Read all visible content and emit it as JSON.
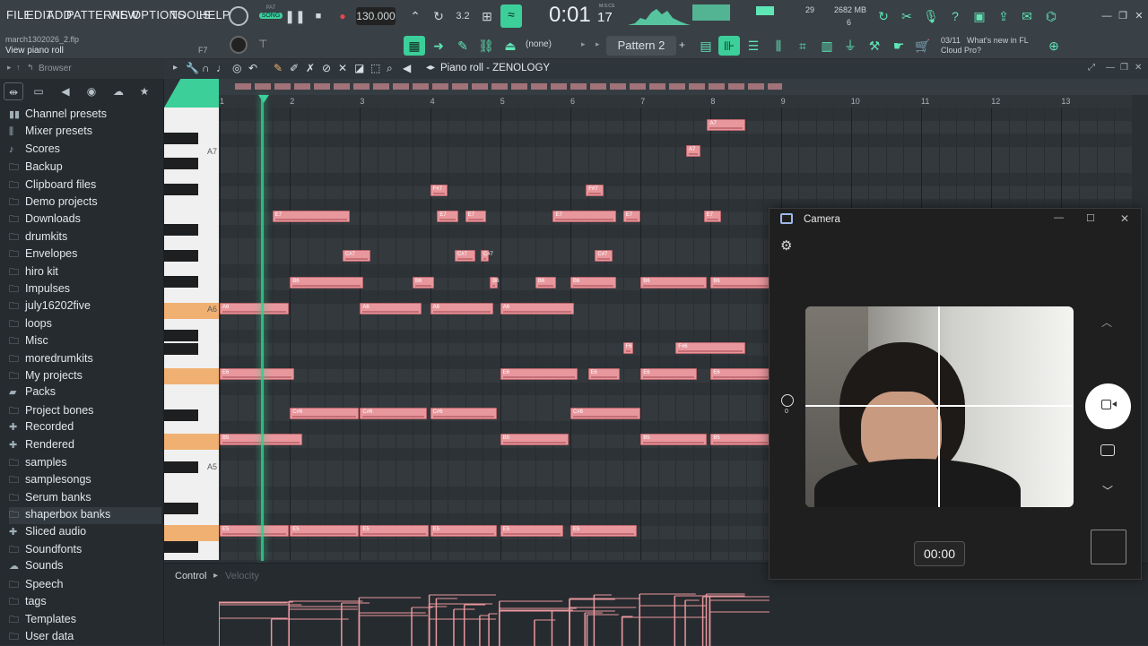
{
  "menu": {
    "items": [
      "FILE",
      "EDIT",
      "ADD",
      "PATTERNS",
      "VIEW",
      "OPTIONS",
      "TOOLS",
      "HELP"
    ]
  },
  "transport": {
    "pat_label": "PAT",
    "song_label": "SONG",
    "tempo": "130.000",
    "time": "0:01",
    "time_sub": "17",
    "time_unit": "M:S:CS",
    "cpu": "29",
    "memory": "2682 MB",
    "voices": "6"
  },
  "project": {
    "filename": "march1302026_2.flp",
    "hint": "View piano roll",
    "hint_key": "F7"
  },
  "toolbar2": {
    "channel_none": "(none)",
    "pattern": "Pattern 2",
    "news_date": "03/11",
    "news_text_1": "What's new in FL",
    "news_text_2": "Cloud Pro?"
  },
  "browser": {
    "title": "Browser",
    "items": [
      {
        "icon": "channel-presets-icon",
        "label": "Channel presets"
      },
      {
        "icon": "mixer-presets-icon",
        "label": "Mixer presets"
      },
      {
        "icon": "scores-icon",
        "label": "Scores"
      },
      {
        "icon": "folder-icon",
        "label": "Backup"
      },
      {
        "icon": "folder-icon",
        "label": "Clipboard files"
      },
      {
        "icon": "folder-icon",
        "label": "Demo projects"
      },
      {
        "icon": "folder-icon",
        "label": "Downloads"
      },
      {
        "icon": "folder-icon",
        "label": "drumkits"
      },
      {
        "icon": "folder-icon",
        "label": "Envelopes"
      },
      {
        "icon": "folder-icon",
        "label": "hiro kit"
      },
      {
        "icon": "folder-icon",
        "label": "Impulses"
      },
      {
        "icon": "folder-icon",
        "label": "july16202five"
      },
      {
        "icon": "folder-icon",
        "label": "loops"
      },
      {
        "icon": "folder-icon",
        "label": "Misc"
      },
      {
        "icon": "folder-icon",
        "label": "moredrumkits"
      },
      {
        "icon": "folder-icon",
        "label": "My projects"
      },
      {
        "icon": "packs-icon",
        "label": "Packs"
      },
      {
        "icon": "folder-icon",
        "label": "Project bones"
      },
      {
        "icon": "recorded-icon",
        "label": "Recorded"
      },
      {
        "icon": "rendered-icon",
        "label": "Rendered"
      },
      {
        "icon": "folder-icon",
        "label": "samples"
      },
      {
        "icon": "folder-icon",
        "label": "samplesongs"
      },
      {
        "icon": "folder-icon",
        "label": "Serum banks"
      },
      {
        "icon": "folder-icon",
        "label": "shaperbox banks"
      },
      {
        "icon": "sliced-audio-icon",
        "label": "Sliced audio"
      },
      {
        "icon": "folder-icon",
        "label": "Soundfonts"
      },
      {
        "icon": "cloud-icon",
        "label": "Sounds"
      },
      {
        "icon": "folder-icon",
        "label": "Speech"
      },
      {
        "icon": "folder-icon",
        "label": "tags"
      },
      {
        "icon": "folder-icon",
        "label": "Templates"
      },
      {
        "icon": "folder-icon",
        "label": "User data"
      }
    ]
  },
  "piano_roll": {
    "title": "Piano roll - ZENOLOGY",
    "bar_numbers": [
      "1",
      "2",
      "3",
      "4",
      "5",
      "6",
      "7",
      "8",
      "9",
      "10",
      "11",
      "12",
      "13"
    ],
    "key_labels": {
      "a7": "A7",
      "a6": "A6",
      "a5": "A5"
    },
    "notes": [
      {
        "label": "A7",
        "bar": 7.95,
        "len": 0.55,
        "row": 0
      },
      {
        "label": "A7",
        "bar": 7.65,
        "len": 0.2,
        "row": 1
      },
      {
        "label": "F#7",
        "bar": 4.0,
        "len": 0.25,
        "row": 2
      },
      {
        "label": "F#7",
        "bar": 6.22,
        "len": 0.25,
        "row": 2
      },
      {
        "label": "E7",
        "bar": 1.75,
        "len": 1.1,
        "row": 3
      },
      {
        "label": "E7",
        "bar": 4.1,
        "len": 0.3,
        "row": 3
      },
      {
        "label": "E7",
        "bar": 4.5,
        "len": 0.3,
        "row": 3
      },
      {
        "label": "E7",
        "bar": 5.75,
        "len": 0.9,
        "row": 3
      },
      {
        "label": "E7",
        "bar": 6.75,
        "len": 0.25,
        "row": 3
      },
      {
        "label": "E7",
        "bar": 7.9,
        "len": 0.25,
        "row": 3
      },
      {
        "label": "C#7",
        "bar": 2.75,
        "len": 0.4,
        "row": 4
      },
      {
        "label": "C#7",
        "bar": 4.35,
        "len": 0.3,
        "row": 4
      },
      {
        "label": "C#7",
        "bar": 4.72,
        "len": 0.12,
        "row": 4
      },
      {
        "label": "C#7",
        "bar": 6.35,
        "len": 0.25,
        "row": 4
      },
      {
        "label": "B6",
        "bar": 2.0,
        "len": 1.05,
        "row": 5
      },
      {
        "label": "B6",
        "bar": 3.75,
        "len": 0.3,
        "row": 5
      },
      {
        "label": "B6",
        "bar": 4.85,
        "len": 0.12,
        "row": 5
      },
      {
        "label": "B6",
        "bar": 5.5,
        "len": 0.3,
        "row": 5
      },
      {
        "label": "B6",
        "bar": 6.0,
        "len": 0.65,
        "row": 5
      },
      {
        "label": "B6",
        "bar": 7.0,
        "len": 0.95,
        "row": 5
      },
      {
        "label": "B6",
        "bar": 8.0,
        "len": 0.85,
        "row": 5
      },
      {
        "label": "A6",
        "bar": 1.0,
        "len": 0.98,
        "row": 6
      },
      {
        "label": "A6",
        "bar": 3.0,
        "len": 0.88,
        "row": 6
      },
      {
        "label": "A6",
        "bar": 4.0,
        "len": 0.9,
        "row": 6
      },
      {
        "label": "A6",
        "bar": 5.0,
        "len": 1.05,
        "row": 6
      },
      {
        "label": "F6",
        "bar": 6.75,
        "len": 0.15,
        "row": 7
      },
      {
        "label": "F#6",
        "bar": 7.5,
        "len": 1.0,
        "row": 7
      },
      {
        "label": "E6",
        "bar": 1.0,
        "len": 1.06,
        "row": 8
      },
      {
        "label": "E6",
        "bar": 5.0,
        "len": 1.1,
        "row": 8
      },
      {
        "label": "E6",
        "bar": 6.25,
        "len": 0.45,
        "row": 8
      },
      {
        "label": "E6",
        "bar": 7.0,
        "len": 0.8,
        "row": 8
      },
      {
        "label": "E6",
        "bar": 8.0,
        "len": 0.85,
        "row": 8
      },
      {
        "label": "C#6",
        "bar": 2.0,
        "len": 0.98,
        "row": 9
      },
      {
        "label": "C#6",
        "bar": 3.0,
        "len": 0.95,
        "row": 9
      },
      {
        "label": "C#6",
        "bar": 4.0,
        "len": 0.95,
        "row": 9
      },
      {
        "label": "C#6",
        "bar": 6.0,
        "len": 1.0,
        "row": 9
      },
      {
        "label": "B5",
        "bar": 1.0,
        "len": 1.18,
        "row": 10
      },
      {
        "label": "B5",
        "bar": 5.0,
        "len": 0.98,
        "row": 10
      },
      {
        "label": "B5",
        "bar": 7.0,
        "len": 0.95,
        "row": 10
      },
      {
        "label": "B5",
        "bar": 8.0,
        "len": 0.85,
        "row": 10
      },
      {
        "label": "E5",
        "bar": 1.0,
        "len": 0.98,
        "row": 11
      },
      {
        "label": "E5",
        "bar": 2.0,
        "len": 0.98,
        "row": 11
      },
      {
        "label": "E5",
        "bar": 3.0,
        "len": 0.98,
        "row": 11
      },
      {
        "label": "E5",
        "bar": 4.0,
        "len": 0.95,
        "row": 11
      },
      {
        "label": "E5",
        "bar": 5.0,
        "len": 0.9,
        "row": 11
      },
      {
        "label": "E5",
        "bar": 6.0,
        "len": 0.95,
        "row": 11
      }
    ]
  },
  "control": {
    "label": "Control",
    "param": "Velocity"
  },
  "camera": {
    "title": "Camera",
    "zoom_value": "0",
    "timer": "00:00"
  },
  "colors": {
    "accent": "#3ccf9a",
    "note": "#e8979d",
    "playhead": "#2fd18e"
  }
}
